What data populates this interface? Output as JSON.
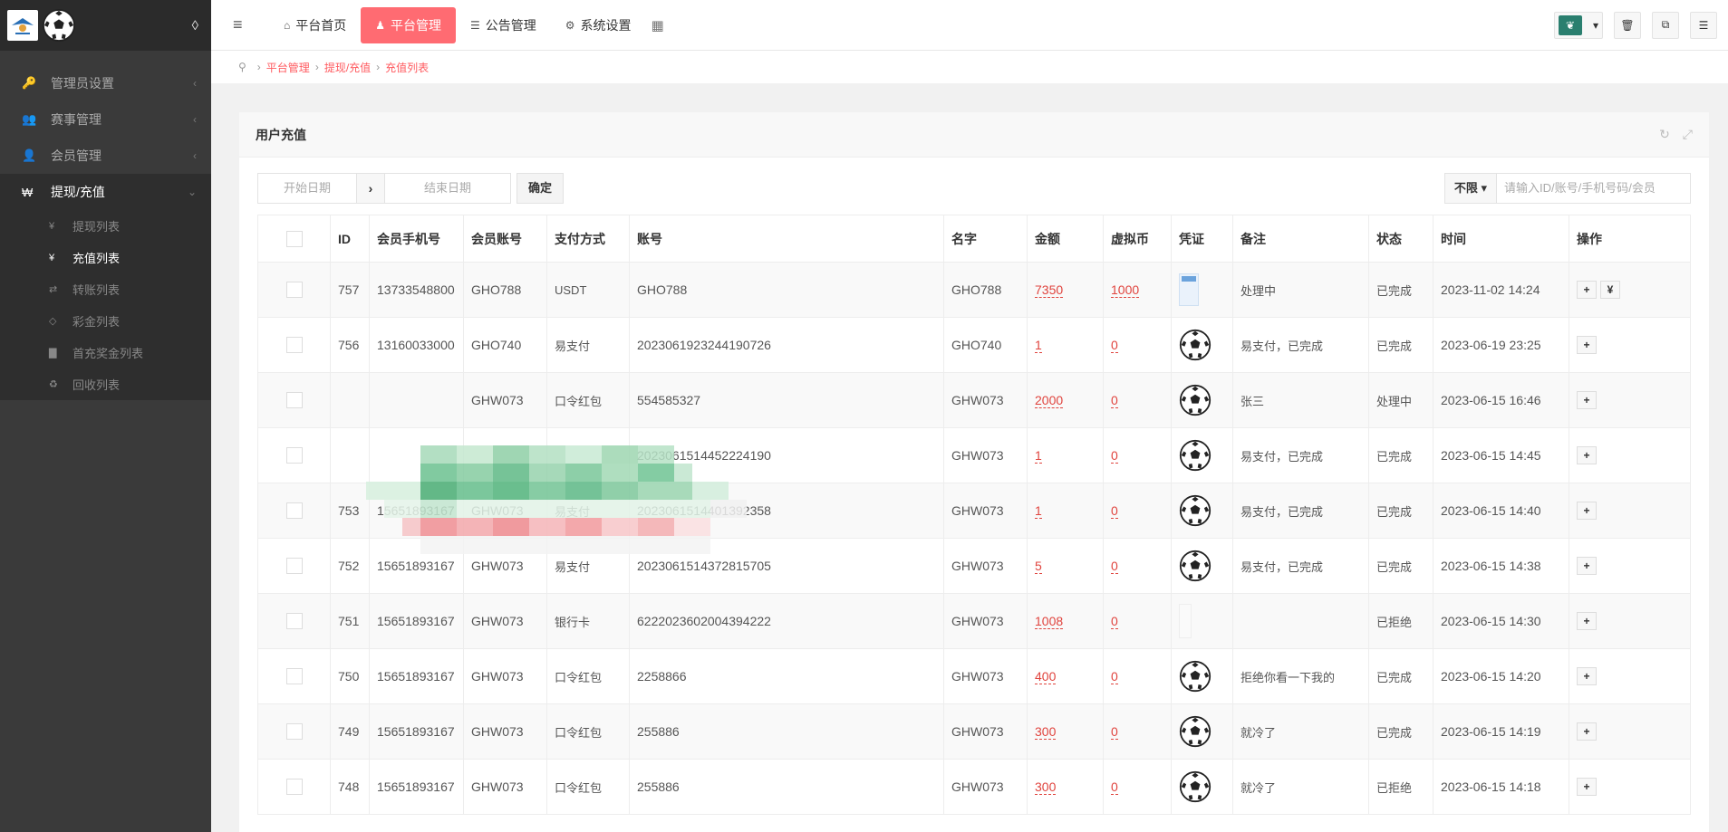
{
  "sidebar": {
    "items": [
      {
        "icon": "key-icon",
        "glyph": "🔑",
        "label": "管理员设置",
        "active": false
      },
      {
        "icon": "users-icon",
        "glyph": "👥",
        "label": "赛事管理",
        "active": false
      },
      {
        "icon": "member-icon",
        "glyph": "👤",
        "label": "会员管理",
        "active": false
      },
      {
        "icon": "won-icon",
        "glyph": "₩",
        "label": "提现/充值",
        "active": true
      }
    ],
    "subitems": [
      {
        "icon": "yen-icon",
        "glyph": "¥",
        "label": "提现列表",
        "active": false
      },
      {
        "icon": "yen-icon",
        "glyph": "¥",
        "label": "充值列表",
        "active": true
      },
      {
        "icon": "exchange-icon",
        "glyph": "⇄",
        "label": "转账列表",
        "active": false
      },
      {
        "icon": "diamond-icon",
        "glyph": "◇",
        "label": "彩金列表",
        "active": false
      },
      {
        "icon": "file-icon",
        "glyph": "▇",
        "label": "首充奖金列表",
        "active": false
      },
      {
        "icon": "recycle-icon",
        "glyph": "♻",
        "label": "回收列表",
        "active": false
      }
    ]
  },
  "topbar": {
    "nav": [
      {
        "icon": "home-icon",
        "glyph": "⌂",
        "label": "平台首页",
        "active": false
      },
      {
        "icon": "user-icon",
        "glyph": "♟",
        "label": "平台管理",
        "active": true
      },
      {
        "icon": "list-icon",
        "glyph": "☰",
        "label": "公告管理",
        "active": false
      },
      {
        "icon": "gear-icon",
        "glyph": "⚙",
        "label": "系统设置",
        "active": false
      }
    ]
  },
  "breadcrumb": [
    "平台管理",
    "提现/充值",
    "充值列表"
  ],
  "panel": {
    "title": "用户充值",
    "start_placeholder": "开始日期",
    "end_placeholder": "结束日期",
    "confirm_label": "确定",
    "filter_select": "不限",
    "search_placeholder": "请输入ID/账号/手机号码/会员"
  },
  "table": {
    "headers": [
      "ID",
      "会员手机号",
      "会员账号",
      "支付方式",
      "账号",
      "名字",
      "金额",
      "虚拟币",
      "凭证",
      "备注",
      "状态",
      "时间",
      "操作"
    ],
    "rows": [
      {
        "id": "757",
        "phone": "13733548800",
        "account": "GHO788",
        "pay": "USDT",
        "number": "GHO788",
        "name": "GHO788",
        "amount": "7350",
        "coin": "1000",
        "voucher": "image",
        "note": "处理中",
        "status": "已完成",
        "time": "2023-11-02 14:24",
        "ops": 2
      },
      {
        "id": "756",
        "phone": "13160033000",
        "account": "GHO740",
        "pay": "易支付",
        "number": "2023061923244190726",
        "name": "GHO740",
        "amount": "1",
        "coin": "0",
        "voucher": "ball",
        "note": "易支付，已完成",
        "status": "已完成",
        "time": "2023-06-19 23:25",
        "ops": 1
      },
      {
        "id": "",
        "phone": "",
        "account": "GHW073",
        "pay": "口令红包",
        "number": "554585327",
        "name": "GHW073",
        "amount": "2000",
        "coin": "0",
        "voucher": "ball",
        "note": "张三",
        "status": "处理中",
        "time": "2023-06-15 16:46",
        "ops": 1
      },
      {
        "id": "",
        "phone": "",
        "account": "",
        "pay": "",
        "number": "2023061514452224190",
        "name": "GHW073",
        "amount": "1",
        "coin": "0",
        "voucher": "ball",
        "note": "易支付，已完成",
        "status": "已完成",
        "time": "2023-06-15 14:45",
        "ops": 1
      },
      {
        "id": "753",
        "phone": "15651893167",
        "account": "GHW073",
        "pay": "易支付",
        "number": "2023061514401392358",
        "name": "GHW073",
        "amount": "1",
        "coin": "0",
        "voucher": "ball",
        "note": "易支付，已完成",
        "status": "已完成",
        "time": "2023-06-15 14:40",
        "ops": 1
      },
      {
        "id": "752",
        "phone": "15651893167",
        "account": "GHW073",
        "pay": "易支付",
        "number": "2023061514372815705",
        "name": "GHW073",
        "amount": "5",
        "coin": "0",
        "voucher": "ball",
        "note": "易支付，已完成",
        "status": "已完成",
        "time": "2023-06-15 14:38",
        "ops": 1
      },
      {
        "id": "751",
        "phone": "15651893167",
        "account": "GHW073",
        "pay": "银行卡",
        "number": "6222023602004394222",
        "name": "GHW073",
        "amount": "1008",
        "coin": "0",
        "voucher": "blank",
        "note": "",
        "status": "已拒绝",
        "time": "2023-06-15 14:30",
        "ops": 1
      },
      {
        "id": "750",
        "phone": "15651893167",
        "account": "GHW073",
        "pay": "口令红包",
        "number": "2258866",
        "name": "GHW073",
        "amount": "400",
        "coin": "0",
        "voucher": "ball",
        "note": "拒绝你看一下我的",
        "status": "已完成",
        "time": "2023-06-15 14:20",
        "ops": 1
      },
      {
        "id": "749",
        "phone": "15651893167",
        "account": "GHW073",
        "pay": "口令红包",
        "number": "255886",
        "name": "GHW073",
        "amount": "300",
        "coin": "0",
        "voucher": "ball",
        "note": "就冷了",
        "status": "已完成",
        "time": "2023-06-15 14:19",
        "ops": 1
      },
      {
        "id": "748",
        "phone": "15651893167",
        "account": "GHW073",
        "pay": "口令红包",
        "number": "255886",
        "name": "GHW073",
        "amount": "300",
        "coin": "0",
        "voucher": "ball",
        "note": "就冷了",
        "status": "已拒绝",
        "time": "2023-06-15 14:18",
        "ops": 1
      }
    ]
  }
}
